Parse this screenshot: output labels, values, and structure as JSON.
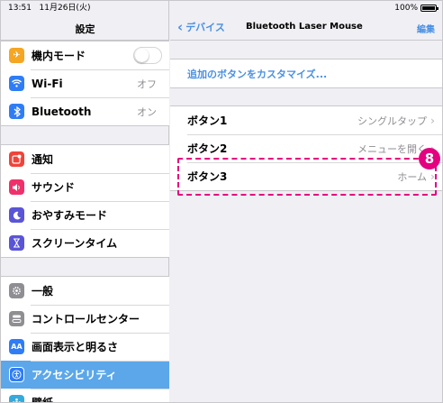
{
  "status": {
    "time": "13:51",
    "date": "11月26日(火)",
    "battery": "100%"
  },
  "sidebar": {
    "title": "設定",
    "groups": [
      [
        {
          "label": "機内モード",
          "icon": "airplane-icon",
          "color": "#f5a623",
          "toggle": true
        },
        {
          "label": "Wi-Fi",
          "value": "オフ",
          "icon": "wifi-icon",
          "color": "#2f7df6"
        },
        {
          "label": "Bluetooth",
          "value": "オン",
          "icon": "bluetooth-icon",
          "color": "#2f7df6"
        }
      ],
      [
        {
          "label": "通知",
          "icon": "notifications-icon",
          "color": "#f0443a"
        },
        {
          "label": "サウンド",
          "icon": "sound-icon",
          "color": "#f0306b"
        },
        {
          "label": "おやすみモード",
          "icon": "moon-icon",
          "color": "#5a55d6"
        },
        {
          "label": "スクリーンタイム",
          "icon": "hourglass-icon",
          "color": "#5a55d6"
        }
      ],
      [
        {
          "label": "一般",
          "icon": "gear-icon",
          "color": "#8e8e93"
        },
        {
          "label": "コントロールセンター",
          "icon": "switches-icon",
          "color": "#8e8e93"
        },
        {
          "label": "画面表示と明るさ",
          "icon": "display-icon",
          "color": "#2f7df6"
        },
        {
          "label": "アクセシビリティ",
          "icon": "accessibility-icon",
          "color": "#2f7df6",
          "selected": true
        },
        {
          "label": "壁紙",
          "icon": "wallpaper-icon",
          "color": "#36aadc"
        }
      ]
    ]
  },
  "detail": {
    "back_label": "デバイス",
    "title": "Bluetooth Laser Mouse",
    "edit_label": "編集",
    "customize_label": "追加のボタンをカスタマイズ...",
    "buttons": [
      {
        "label": "ボタン1",
        "value": "シングルタップ"
      },
      {
        "label": "ボタン2",
        "value": "メニューを開く"
      },
      {
        "label": "ボタン3",
        "value": "ホーム"
      }
    ],
    "callout_number": "8",
    "accent": "#4a90e2",
    "highlight_color": "#e4007f"
  }
}
